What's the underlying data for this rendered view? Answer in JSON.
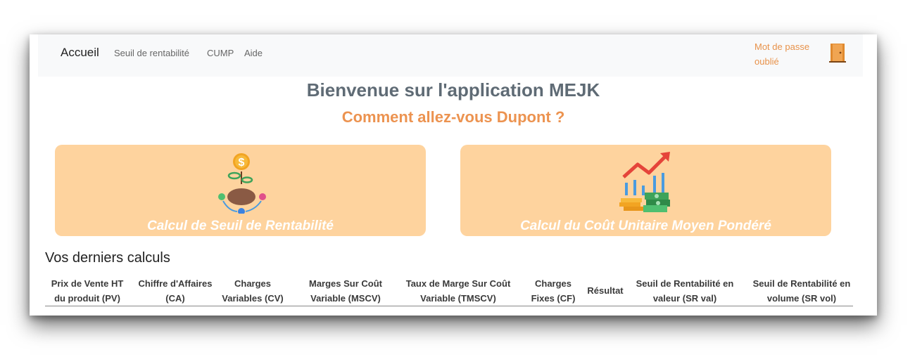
{
  "navbar": {
    "brand": "Accueil",
    "links": [
      "Seuil de rentabilité",
      "CUMP",
      "Aide"
    ],
    "forgot_password": "Mot de passe oublié"
  },
  "welcome": {
    "title": "Bienvenue sur l'application MEJK",
    "subtitle": "Comment allez-vous Dupont ?"
  },
  "cards": [
    {
      "label": "Calcul de Seuil de Rentabilité",
      "icon": "money-plant-icon"
    },
    {
      "label": "Calcul du Coût Unitaire Moyen Pondéré",
      "icon": "growth-chart-coins-icon"
    }
  ],
  "recent": {
    "title": "Vos derniers calculs",
    "headers": [
      "Prix de Vente HT du produit (PV)",
      "Chiffre d'Affaires (CA)",
      "Charges Variables (CV)",
      "Marges Sur Coût Variable (MSCV)",
      "Taux de Marge Sur Coût Variable (TMSCV)",
      "Charges Fixes (CF)",
      "Résultat",
      "Seuil de Rentabilité en valeur (SR val)",
      "Seuil de Rentabilité en volume (SR vol)"
    ]
  },
  "colors": {
    "accent": "#ec9350",
    "card_bg": "#fed39e",
    "title": "#5f6b75"
  }
}
